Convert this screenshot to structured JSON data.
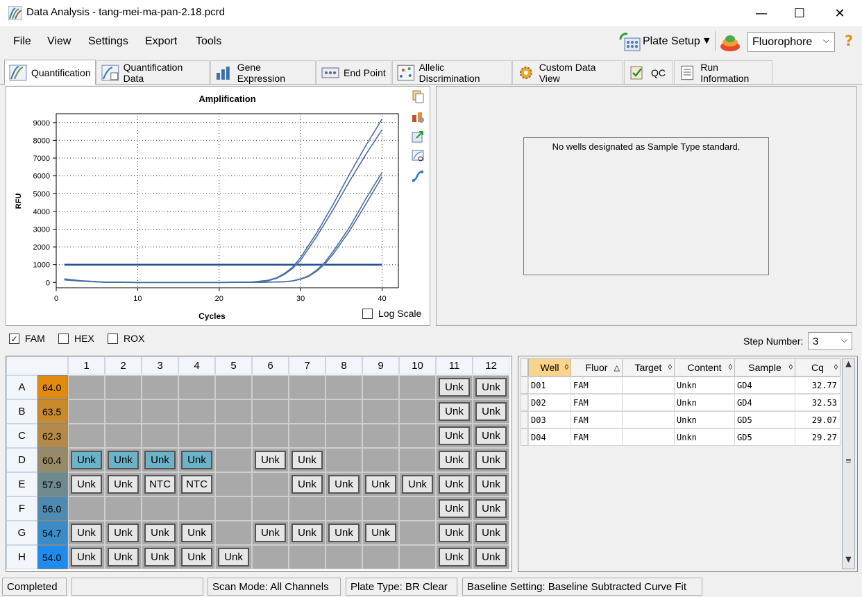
{
  "window": {
    "title": "Data Analysis - tang-mei-ma-pan-2.18.pcrd",
    "minimize": "—",
    "maximize": "☐",
    "close": "✕"
  },
  "menu": {
    "file": "File",
    "view": "View",
    "settings": "Settings",
    "export": "Export",
    "tools": "Tools"
  },
  "toolbar": {
    "plate_setup": "Plate Setup",
    "fluorophore": "Fluorophore",
    "help": "?"
  },
  "tabs": [
    {
      "label": "Quantification"
    },
    {
      "label": "Quantification Data"
    },
    {
      "label": "Gene Expression"
    },
    {
      "label": "End Point"
    },
    {
      "label": "Allelic Discrimination"
    },
    {
      "label": "Custom Data View"
    },
    {
      "label": "QC"
    },
    {
      "label": "Run Information"
    }
  ],
  "chart_data": {
    "type": "line",
    "title": "Amplification",
    "xlabel": "Cycles",
    "ylabel": "RFU",
    "xlim": [
      0,
      42
    ],
    "ylim": [
      -300,
      9500
    ],
    "xticks": [
      0,
      10,
      20,
      30,
      40
    ],
    "yticks": [
      0,
      1000,
      2000,
      3000,
      4000,
      5000,
      6000,
      7000,
      8000,
      9000
    ],
    "grid": true,
    "threshold": 1000,
    "series": [
      {
        "x": [
          1,
          3,
          6,
          10,
          15,
          20,
          24,
          26,
          27,
          28,
          29,
          30,
          32,
          34,
          36,
          38,
          40
        ],
        "values": [
          200,
          100,
          20,
          0,
          0,
          0,
          20,
          120,
          250,
          500,
          850,
          1400,
          2800,
          4400,
          6100,
          7700,
          9200
        ]
      },
      {
        "x": [
          1,
          3,
          6,
          10,
          15,
          20,
          24,
          26,
          27,
          28,
          29,
          30,
          32,
          34,
          36,
          38,
          40
        ],
        "values": [
          180,
          90,
          15,
          0,
          0,
          0,
          15,
          100,
          220,
          450,
          780,
          1250,
          2600,
          4100,
          5700,
          7200,
          8600
        ]
      },
      {
        "x": [
          1,
          3,
          6,
          10,
          15,
          20,
          25,
          28,
          29,
          30,
          31,
          32,
          33,
          34,
          36,
          38,
          40
        ],
        "values": [
          150,
          80,
          10,
          0,
          0,
          0,
          10,
          40,
          90,
          200,
          380,
          700,
          1150,
          1750,
          3100,
          4700,
          6200
        ]
      },
      {
        "x": [
          1,
          3,
          6,
          10,
          15,
          20,
          25,
          28,
          29,
          30,
          31,
          32,
          33,
          34,
          36,
          38,
          40
        ],
        "values": [
          140,
          70,
          10,
          0,
          0,
          0,
          10,
          35,
          80,
          180,
          340,
          640,
          1050,
          1600,
          2900,
          4400,
          5950
        ]
      }
    ]
  },
  "chart": {
    "log_scale_label": "Log Scale"
  },
  "standard_panel": {
    "message": "No wells designated as Sample Type standard."
  },
  "fluor_filters": [
    {
      "label": "FAM",
      "checked": "✓"
    },
    {
      "label": "HEX",
      "checked": ""
    },
    {
      "label": "ROX",
      "checked": ""
    }
  ],
  "step": {
    "label": "Step Number:",
    "value": "3"
  },
  "plate": {
    "columns": [
      "1",
      "2",
      "3",
      "4",
      "5",
      "6",
      "7",
      "8",
      "9",
      "10",
      "11",
      "12"
    ],
    "rows": [
      {
        "label": "A",
        "temp": "64.0",
        "temp_color": "#e08a10",
        "wells": [
          "",
          "",
          "",
          "",
          "",
          "",
          "",
          "",
          "",
          "",
          "Unk",
          "Unk"
        ]
      },
      {
        "label": "B",
        "temp": "63.5",
        "temp_color": "#c98a2c",
        "wells": [
          "",
          "",
          "",
          "",
          "",
          "",
          "",
          "",
          "",
          "",
          "Unk",
          "Unk"
        ]
      },
      {
        "label": "C",
        "temp": "62.3",
        "temp_color": "#b58a48",
        "wells": [
          "",
          "",
          "",
          "",
          "",
          "",
          "",
          "",
          "",
          "",
          "Unk",
          "Unk"
        ]
      },
      {
        "label": "D",
        "temp": "60.4",
        "temp_color": "#978a66",
        "wells": [
          "Unk",
          "Unk",
          "Unk",
          "Unk",
          "",
          "Unk",
          "Unk",
          "",
          "",
          "",
          "Unk",
          "Unk"
        ],
        "selected": [
          0,
          1,
          2,
          3
        ]
      },
      {
        "label": "E",
        "temp": "57.9",
        "temp_color": "#6f8a8e",
        "wells": [
          "Unk",
          "Unk",
          "NTC",
          "NTC",
          "",
          "",
          "Unk",
          "Unk",
          "Unk",
          "Unk",
          "Unk",
          "Unk"
        ]
      },
      {
        "label": "F",
        "temp": "56.0",
        "temp_color": "#4f8ab0",
        "wells": [
          "",
          "",
          "",
          "",
          "",
          "",
          "",
          "",
          "",
          "",
          "Unk",
          "Unk"
        ]
      },
      {
        "label": "G",
        "temp": "54.7",
        "temp_color": "#3a8bc8",
        "wells": [
          "Unk",
          "Unk",
          "Unk",
          "Unk",
          "",
          "Unk",
          "Unk",
          "Unk",
          "Unk",
          "",
          "Unk",
          "Unk"
        ]
      },
      {
        "label": "H",
        "temp": "54.0",
        "temp_color": "#1f8bea",
        "wells": [
          "Unk",
          "Unk",
          "Unk",
          "Unk",
          "Unk",
          "",
          "",
          "",
          "",
          "",
          "Unk",
          "Unk"
        ]
      }
    ]
  },
  "table": {
    "headers": [
      "Well",
      "Fluor",
      "Target",
      "Content",
      "Sample",
      "Cq"
    ],
    "rows": [
      [
        "D01",
        "FAM",
        "",
        "Unkn",
        "GD4",
        "32.77"
      ],
      [
        "D02",
        "FAM",
        "",
        "Unkn",
        "GD4",
        "32.53"
      ],
      [
        "D03",
        "FAM",
        "",
        "Unkn",
        "GD5",
        "29.07"
      ],
      [
        "D04",
        "FAM",
        "",
        "Unkn",
        "GD5",
        "29.27"
      ]
    ]
  },
  "status": {
    "state": "Completed",
    "scan_mode": "Scan Mode: All Channels",
    "plate_type": "Plate Type: BR Clear",
    "baseline": "Baseline Setting: Baseline Subtracted Curve Fit"
  },
  "colors": {
    "curve": "#4a6fa5",
    "threshold": "#1f4f8f",
    "selected_well": "#6cb2c8",
    "sorted_header": "#fbd38a"
  }
}
